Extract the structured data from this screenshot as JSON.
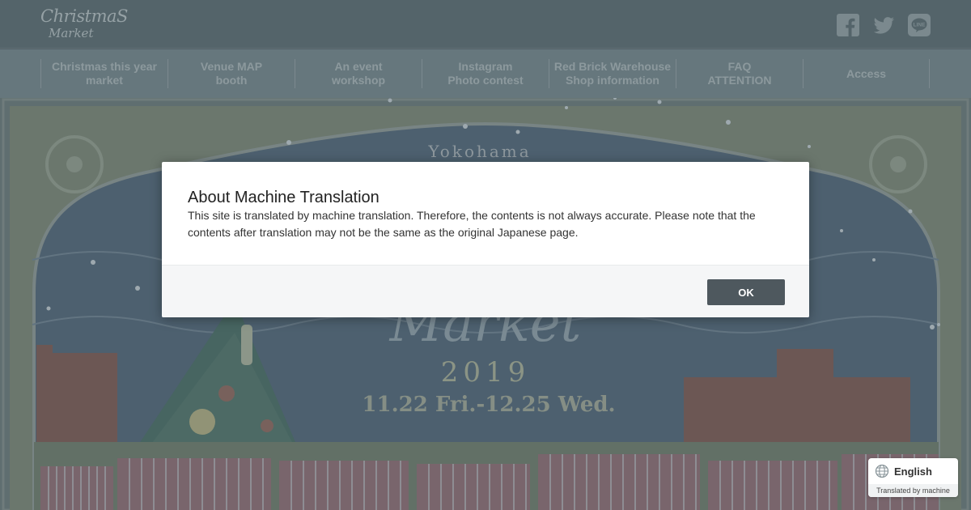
{
  "header": {
    "logo_line1": "ChristmaS",
    "logo_line2": "Market"
  },
  "social": {
    "facebook": "facebook-icon",
    "twitter": "twitter-icon",
    "line": "line-icon"
  },
  "nav": {
    "items": [
      {
        "line1": "Christmas this year",
        "line2": "market"
      },
      {
        "line1": "Venue MAP",
        "line2": "booth"
      },
      {
        "line1": "An event",
        "line2": "workshop"
      },
      {
        "line1": "Instagram",
        "line2": "Photo contest"
      },
      {
        "line1": "Red Brick Warehouse",
        "line2": "Shop information"
      },
      {
        "line1": "FAQ",
        "line2": "ATTENTION"
      },
      {
        "line1": "Access",
        "line2": ""
      }
    ]
  },
  "hero": {
    "city": "Yokohama",
    "market_word": "Market",
    "year": "2019",
    "dates": "11.22 Fri.-12.25 Wed."
  },
  "modal": {
    "title": "About Machine Translation",
    "text": "This site is translated by machine translation. Therefore, the contents is not always accurate. Please note that the contents after translation may not be the same as the original Japanese page.",
    "ok_label": "OK"
  },
  "language_widget": {
    "label": "English",
    "sub_label": "Translated by machine",
    "icon": "globe-icon"
  },
  "colors": {
    "modal_button": "#4e585e",
    "overlay": "#5d6b72"
  }
}
